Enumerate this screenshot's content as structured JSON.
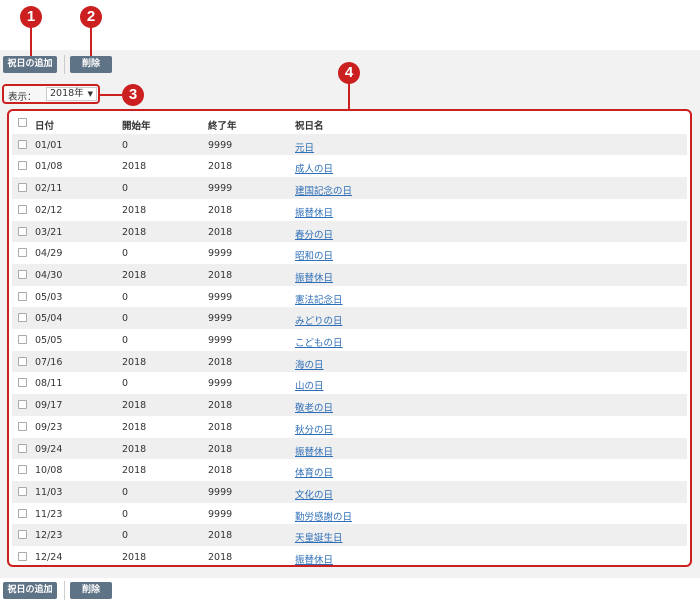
{
  "toolbar": {
    "add_label": "祝日の追加",
    "delete_label": "削除"
  },
  "filter": {
    "label": "表示：",
    "selected_year": "2018年"
  },
  "markers": [
    "1",
    "2",
    "3",
    "4"
  ],
  "table": {
    "headers": {
      "date": "日付",
      "start": "開始年",
      "end": "終了年",
      "name": "祝日名"
    },
    "rows": [
      {
        "date": "01/01",
        "start": "0",
        "end": "9999",
        "name": "元日"
      },
      {
        "date": "01/08",
        "start": "2018",
        "end": "2018",
        "name": "成人の日"
      },
      {
        "date": "02/11",
        "start": "0",
        "end": "9999",
        "name": "建国記念の日"
      },
      {
        "date": "02/12",
        "start": "2018",
        "end": "2018",
        "name": "振替休日"
      },
      {
        "date": "03/21",
        "start": "2018",
        "end": "2018",
        "name": "春分の日"
      },
      {
        "date": "04/29",
        "start": "0",
        "end": "9999",
        "name": "昭和の日"
      },
      {
        "date": "04/30",
        "start": "2018",
        "end": "2018",
        "name": "振替休日"
      },
      {
        "date": "05/03",
        "start": "0",
        "end": "9999",
        "name": "憲法記念日"
      },
      {
        "date": "05/04",
        "start": "0",
        "end": "9999",
        "name": "みどりの日"
      },
      {
        "date": "05/05",
        "start": "0",
        "end": "9999",
        "name": "こどもの日"
      },
      {
        "date": "07/16",
        "start": "2018",
        "end": "2018",
        "name": "海の日"
      },
      {
        "date": "08/11",
        "start": "0",
        "end": "9999",
        "name": "山の日"
      },
      {
        "date": "09/17",
        "start": "2018",
        "end": "2018",
        "name": "敬老の日"
      },
      {
        "date": "09/23",
        "start": "2018",
        "end": "2018",
        "name": "秋分の日"
      },
      {
        "date": "09/24",
        "start": "2018",
        "end": "2018",
        "name": "振替休日"
      },
      {
        "date": "10/08",
        "start": "2018",
        "end": "2018",
        "name": "体育の日"
      },
      {
        "date": "11/03",
        "start": "0",
        "end": "9999",
        "name": "文化の日"
      },
      {
        "date": "11/23",
        "start": "0",
        "end": "9999",
        "name": "勤労感謝の日"
      },
      {
        "date": "12/23",
        "start": "0",
        "end": "2018",
        "name": "天皇誕生日"
      },
      {
        "date": "12/24",
        "start": "2018",
        "end": "2018",
        "name": "振替休日"
      }
    ]
  }
}
